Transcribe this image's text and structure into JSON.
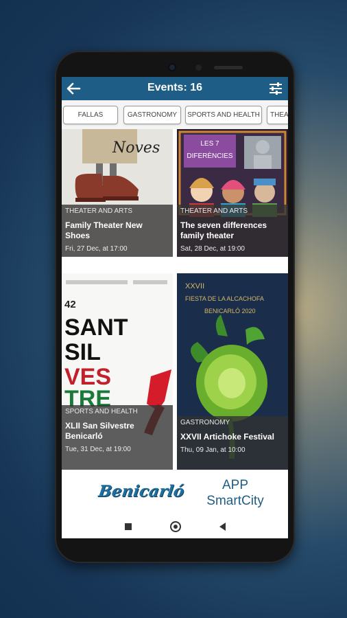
{
  "appbar": {
    "title": "Events: 16"
  },
  "categories": [
    {
      "label": "FALLAS"
    },
    {
      "label": "GASTRONOMY"
    },
    {
      "label": "SPORTS AND HEALTH"
    },
    {
      "label": "THEA"
    }
  ],
  "events": [
    {
      "category": "THEATER AND ARTS",
      "title": "Family Theater New Shoes",
      "date": "Fri, 27 Dec, at 17:00",
      "poster_text": "Noves"
    },
    {
      "category": "THEATER AND ARTS",
      "title": "The seven differences family theater",
      "date": "Sat, 28 Dec, at 19:00",
      "poster_text_1": "LES 7",
      "poster_text_2": "DIFERÈNCIES"
    },
    {
      "category": "SPORTS AND HEALTH",
      "title": "XLII San Silvestre Benicarló",
      "date": "Tue, 31 Dec, at 19:00",
      "poster_number": "42",
      "poster_word_1": "SANT",
      "poster_word_2": "SIL",
      "poster_word_3": "VES",
      "poster_word_4": "TRE"
    },
    {
      "category": "GASTRONOMY",
      "title": "XXVII Artichoke Festival",
      "date": "Thu, 09 Jan, at 10:00",
      "poster_line_1": "XXVII",
      "poster_line_2": "FIESTA DE LA ALCACHOFA",
      "poster_line_3": "BENICARLÓ 2020"
    }
  ],
  "footer": {
    "logo_text": "Benicarló",
    "app_label": "APP",
    "smartcity_label": "SmartCity"
  },
  "colors": {
    "appbar": "#1e5d86",
    "overlay": "rgba(50,50,50,0.78)"
  }
}
